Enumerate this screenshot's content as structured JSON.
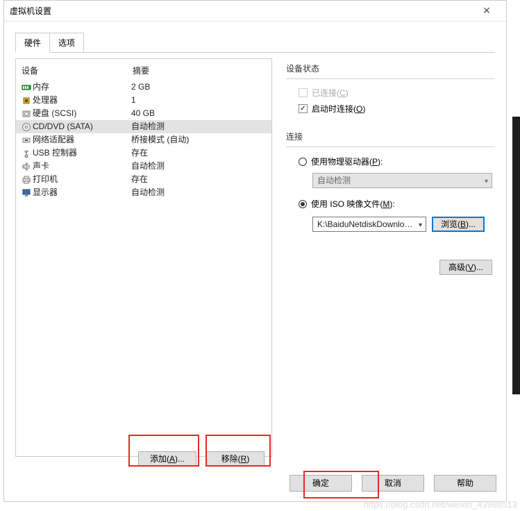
{
  "window": {
    "title": "虚拟机设置"
  },
  "tabs": [
    {
      "label": "硬件",
      "active": true
    },
    {
      "label": "选项",
      "active": false
    }
  ],
  "deviceHeader": {
    "device": "设备",
    "summary": "摘要"
  },
  "devices": [
    {
      "icon": "memory",
      "name": "内存",
      "summary": "2 GB",
      "selected": false
    },
    {
      "icon": "cpu",
      "name": "处理器",
      "summary": "1",
      "selected": false
    },
    {
      "icon": "disk",
      "name": "硬盘 (SCSI)",
      "summary": "40 GB",
      "selected": false
    },
    {
      "icon": "cd",
      "name": "CD/DVD (SATA)",
      "summary": "自动检测",
      "selected": true
    },
    {
      "icon": "net",
      "name": "网络适配器",
      "summary": "桥接模式 (自动)",
      "selected": false
    },
    {
      "icon": "usb",
      "name": "USB 控制器",
      "summary": "存在",
      "selected": false
    },
    {
      "icon": "sound",
      "name": "声卡",
      "summary": "自动检测",
      "selected": false
    },
    {
      "icon": "printer",
      "name": "打印机",
      "summary": "存在",
      "selected": false
    },
    {
      "icon": "display",
      "name": "显示器",
      "summary": "自动检测",
      "selected": false
    }
  ],
  "deviceStatus": {
    "title": "设备状态",
    "connected": {
      "label_pre": "已连接(",
      "hot": "C",
      "label_post": ")",
      "checked": false,
      "disabled": true
    },
    "connectOnPowerOn": {
      "label_pre": "启动时连接(",
      "hot": "O",
      "label_post": ")",
      "checked": true
    }
  },
  "connection": {
    "title": "连接",
    "physical": {
      "label_pre": "使用物理驱动器(",
      "hot": "P",
      "label_post": "):",
      "selected": false,
      "driveLabel": "自动检测"
    },
    "iso": {
      "label_pre": "使用 ISO 映像文件(",
      "hot": "M",
      "label_post": "):",
      "selected": true,
      "path": "K:\\BaiduNetdiskDownload\\rh",
      "browse_pre": "浏览(",
      "browse_hot": "B",
      "browse_post": ")..."
    }
  },
  "advanced": {
    "label_pre": "高级(",
    "hot": "V",
    "label_post": ")..."
  },
  "addRemove": {
    "add_pre": "添加(",
    "add_hot": "A",
    "add_post": ")...",
    "remove_pre": "移除(",
    "remove_hot": "R",
    "remove_post": ")"
  },
  "footer": {
    "ok": "确定",
    "cancel": "取消",
    "help": "帮助"
  },
  "watermark": "https://blog.csdn.net/weixin_43988513"
}
